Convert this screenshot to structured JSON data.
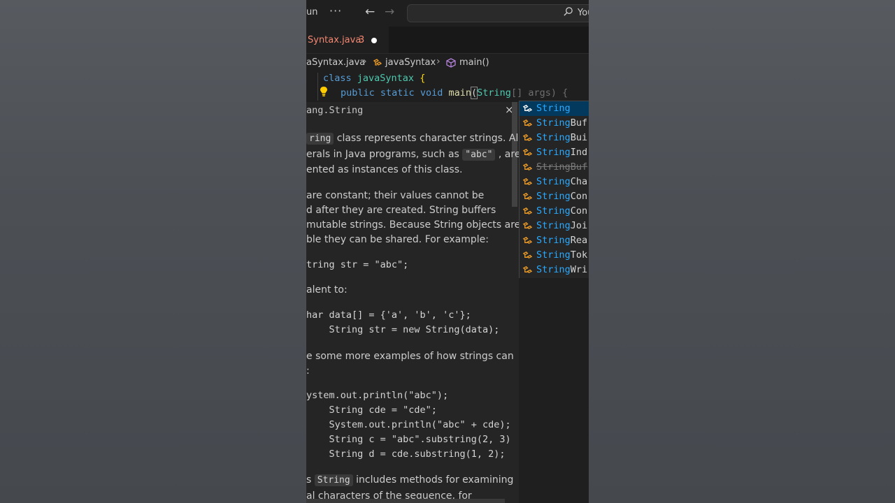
{
  "titlebar": {
    "menu_run": "un",
    "menu_more": "···",
    "search_text": "You"
  },
  "tab": {
    "name": "Syntax.java",
    "problem_count": "3"
  },
  "breadcrumb": {
    "file": "aSyntax.java",
    "class": "javaSyntax",
    "method": "main()"
  },
  "code": {
    "line1": {
      "kw": "class",
      "name": "javaSyntax",
      "brace": "{"
    },
    "line2": {
      "kw1": "public",
      "kw2": "static",
      "kw3": "void",
      "fn": "main",
      "type": "String",
      "arr": "[]",
      "param": "args",
      "tail": ") {"
    }
  },
  "doc": {
    "header": "ang.String",
    "close": "×",
    "p1_code": "ring",
    "p1_l1": "class represents character strings. All",
    "p1_l2a": "erals in Java programs, such as",
    "p1_l2_code": "\"abc\"",
    "p1_l2b": ", are",
    "p1_l3": "ented as instances of this class.",
    "p2_l1": "are constant; their values cannot be",
    "p2_l2": "d after they are created. String buffers",
    "p2_l3": " mutable strings. Because String objects are",
    "p2_l4": "ble they can be shared. For example:",
    "ex1": "tring str = \"abc\";",
    "equiv": "alent to:",
    "ex2_l1": "har data[] = {'a', 'b', 'c'};",
    "ex2_l2": "    String str = new String(data);",
    "p3_l1": "e some more examples of how strings can",
    "p3_l2": ":",
    "ex3_l1": "ystem.out.println(\"abc\");",
    "ex3_l2": "    String cde = \"cde\";",
    "ex3_l3": "    System.out.println(\"abc\" + cde);",
    "ex3_l4": "    String c = \"abc\".substring(2, 3)",
    "ex3_l5": "    String d = cde.substring(1, 2);",
    "p4_a": "s",
    "p4_code": "String",
    "p4_b": "includes methods for examining",
    "p5": "al characters of the sequence, for"
  },
  "suggest": {
    "items": [
      {
        "match": "String",
        "rest": "",
        "selected": true,
        "deprecated": false
      },
      {
        "match": "String",
        "rest": "Buf",
        "selected": false,
        "deprecated": false
      },
      {
        "match": "String",
        "rest": "Bui",
        "selected": false,
        "deprecated": false
      },
      {
        "match": "String",
        "rest": "Ind",
        "selected": false,
        "deprecated": false
      },
      {
        "match": "String",
        "rest": "Buf",
        "selected": false,
        "deprecated": true
      },
      {
        "match": "String",
        "rest": "Cha",
        "selected": false,
        "deprecated": false
      },
      {
        "match": "String",
        "rest": "Con",
        "selected": false,
        "deprecated": false
      },
      {
        "match": "String",
        "rest": "Con",
        "selected": false,
        "deprecated": false
      },
      {
        "match": "String",
        "rest": "Joi",
        "selected": false,
        "deprecated": false
      },
      {
        "match": "String",
        "rest": "Rea",
        "selected": false,
        "deprecated": false
      },
      {
        "match": "String",
        "rest": "Tok",
        "selected": false,
        "deprecated": false
      },
      {
        "match": "String",
        "rest": "Wri",
        "selected": false,
        "deprecated": false
      }
    ]
  },
  "colors": {
    "editor_bg": "#1f1f1f",
    "keyword": "#569cd6",
    "class": "#4ec9b0",
    "function": "#dcdcaa",
    "string": "#ce9178",
    "match_highlight": "#2aaaff",
    "error_tab": "#f48771"
  },
  "icons": [
    "search-icon",
    "arrow-left-icon",
    "arrow-right-icon",
    "class-icon",
    "method-icon",
    "lightbulb-icon",
    "close-icon"
  ]
}
